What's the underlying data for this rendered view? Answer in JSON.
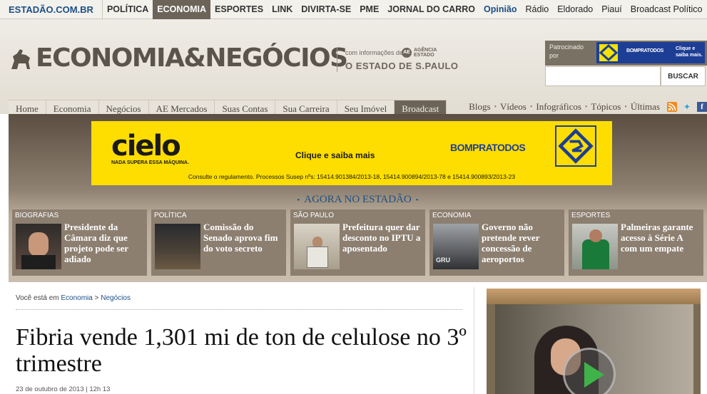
{
  "topnav": {
    "brand": "ESTADÃO.COM.BR",
    "items": [
      "POLÍTICA",
      "ECONOMIA",
      "ESPORTES",
      "LINK",
      "DIVIRTA-SE",
      "PME",
      "JORNAL DO CARRO",
      "Opinião",
      "Rádio",
      "Eldorado",
      "Piauí",
      "Broadcast Político"
    ],
    "active": "ECONOMIA"
  },
  "header": {
    "title": "ECONOMIA&NEGÓCIOS",
    "info_prefix": "com informações de",
    "ae_badge": "AE",
    "ae_label_1": "AGÊNCIA",
    "ae_label_2": "ESTADO",
    "paper_name": "O ESTADO DE S.PAULO",
    "sponsor_label": "Patrocinado por",
    "sponsor_mid": "BOMPRATODOS",
    "sponsor_cta": "Clique e saiba mais."
  },
  "search": {
    "placeholder": "",
    "button_label": "BUSCAR"
  },
  "subnav": {
    "items": [
      "Home",
      "Economia",
      "Negócios",
      "AE Mercados",
      "Suas Contas",
      "Sua Carreira",
      "Seu Imóvel",
      "Broadcast"
    ],
    "active": "Broadcast"
  },
  "utility_links": [
    "Blogs",
    "Vídeos",
    "Infográficos",
    "Tópicos",
    "Últimas"
  ],
  "ad": {
    "brand": "cielo",
    "tagline": "NADA SUPERA ESSA MÁQUINA.",
    "cta": "Clique e saiba mais",
    "partner": "BOMPRATODOS",
    "legal": "Consulte o regulamento. Processos Susep nºs: 15414.901384/2013-18, 15414.900894/2013-78 e 15414.900893/2013-23"
  },
  "agora": {
    "title": "AGORA NO ESTADÃO",
    "cards": [
      {
        "category": "BIOGRAFIAS",
        "title": "Presidente da Câmara diz que projeto pode ser adiado"
      },
      {
        "category": "POLÍTICA",
        "title": "Comissão do Senado aprova fim do voto secreto"
      },
      {
        "category": "SÃO PAULO",
        "title": "Prefeitura quer dar desconto no IPTU a aposentado"
      },
      {
        "category": "ECONOMIA",
        "title": "Governo não pretende rever concessão de aeroportos"
      },
      {
        "category": "ESPORTES",
        "title": "Palmeiras garante acesso à Série A com um empate"
      }
    ]
  },
  "breadcrumb": {
    "prefix": "Você está em",
    "level1": "Economia",
    "separator": ">",
    "level2": "Negócios"
  },
  "article": {
    "title": "Fibria vende 1,301 mi de ton de celulose no 3º trimestre",
    "date": "23 de outubro de 2013 | 12h 13"
  },
  "colors": {
    "brand_blue": "#1c4f86",
    "band_brown": "#8c7f70",
    "ad_yellow": "#fedd00",
    "nav_active": "#6c6459"
  }
}
